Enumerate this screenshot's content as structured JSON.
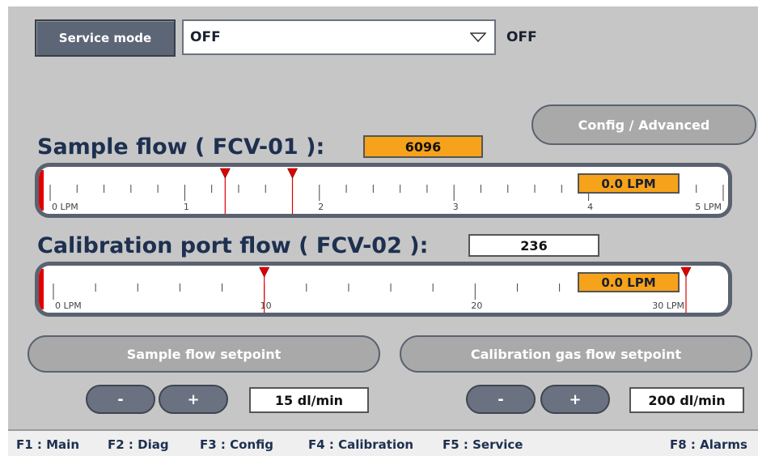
{
  "header": {
    "service_mode_label": "Service mode",
    "dropdown_value": "OFF",
    "status_value": "OFF"
  },
  "config_button_label": "Config / Advanced",
  "sample_flow": {
    "title": "Sample flow ( FCV-01 ):",
    "value_box": "6096",
    "readout": "0.0 LPM",
    "scale": {
      "min": 0,
      "max": 5,
      "unit": "LPM"
    },
    "tick_labels": [
      "0 LPM",
      "1",
      "2",
      "3",
      "4",
      "5 LPM"
    ],
    "markers": [
      1.3,
      1.8
    ],
    "current": 0.0
  },
  "cal_flow": {
    "title": "Calibration port flow ( FCV-02 ):",
    "value_box": "236",
    "readout": "0.0 LPM",
    "scale": {
      "min": 0,
      "max": 30,
      "unit": "LPM"
    },
    "tick_labels": [
      "0 LPM",
      "10",
      "20",
      "30 LPM"
    ],
    "markers": [
      10,
      30
    ],
    "current": 0.0
  },
  "sample_setpoint": {
    "label": "Sample flow setpoint",
    "minus": "-",
    "plus": "+",
    "value": "15 dl/min"
  },
  "cal_setpoint": {
    "label": "Calibration gas flow setpoint",
    "minus": "-",
    "plus": "+",
    "value": "200 dl/min"
  },
  "footer": {
    "f1": "F1 : Main",
    "f2": "F2 : Diag",
    "f3": "F3 : Config",
    "f4": "F4 : Calibration",
    "f5": "F5 : Service",
    "f8": "F8 : Alarms"
  },
  "colors": {
    "panel_bg": "#c6c6c6",
    "accent_orange": "#f6a21a",
    "marker_red": "#e00000",
    "button_dark": "#5d6676"
  },
  "icons": {
    "dropdown": "chevron-down-icon",
    "marker": "setpoint-marker-icon"
  }
}
